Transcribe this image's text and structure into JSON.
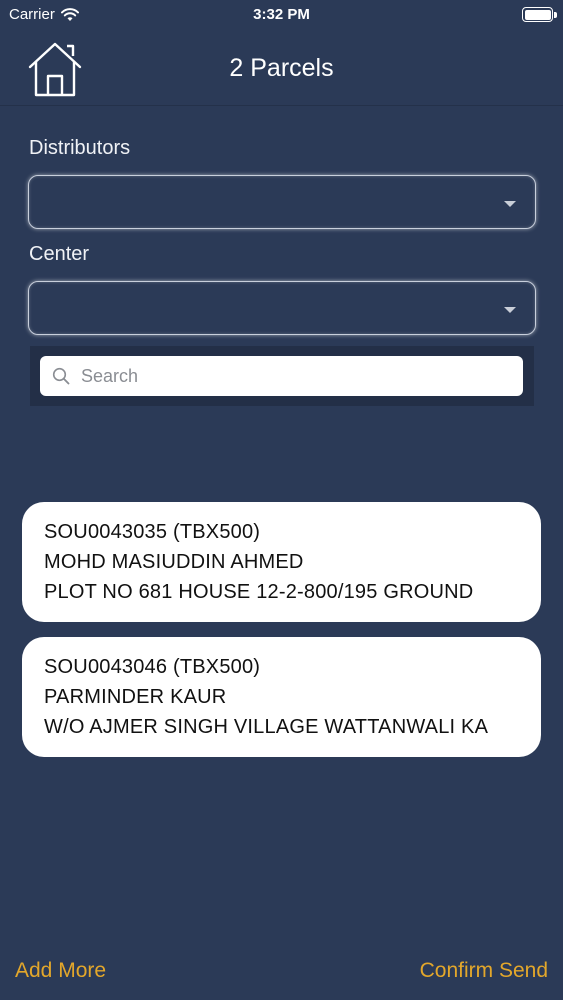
{
  "status_bar": {
    "carrier": "Carrier",
    "time": "3:32 PM"
  },
  "nav": {
    "title": "2 Parcels",
    "home_icon": "home-icon"
  },
  "form": {
    "distributors_label": "Distributors",
    "distributors_value": "",
    "center_label": "Center",
    "center_value": "",
    "search_placeholder": "Search"
  },
  "parcels": [
    {
      "code": "SOU0043035 (TBX500)",
      "name": "MOHD MASIUDDIN AHMED",
      "address": "PLOT NO 681 HOUSE 12-2-800/195 GROUND"
    },
    {
      "code": "SOU0043046 (TBX500)",
      "name": "PARMINDER KAUR",
      "address": "W/O AJMER SINGH VILLAGE WATTANWALI KA"
    }
  ],
  "actions": {
    "add_more": "Add More",
    "confirm_send": "Confirm Send"
  },
  "colors": {
    "background": "#2b3a57",
    "accent": "#e3a72b",
    "card": "#ffffff"
  }
}
